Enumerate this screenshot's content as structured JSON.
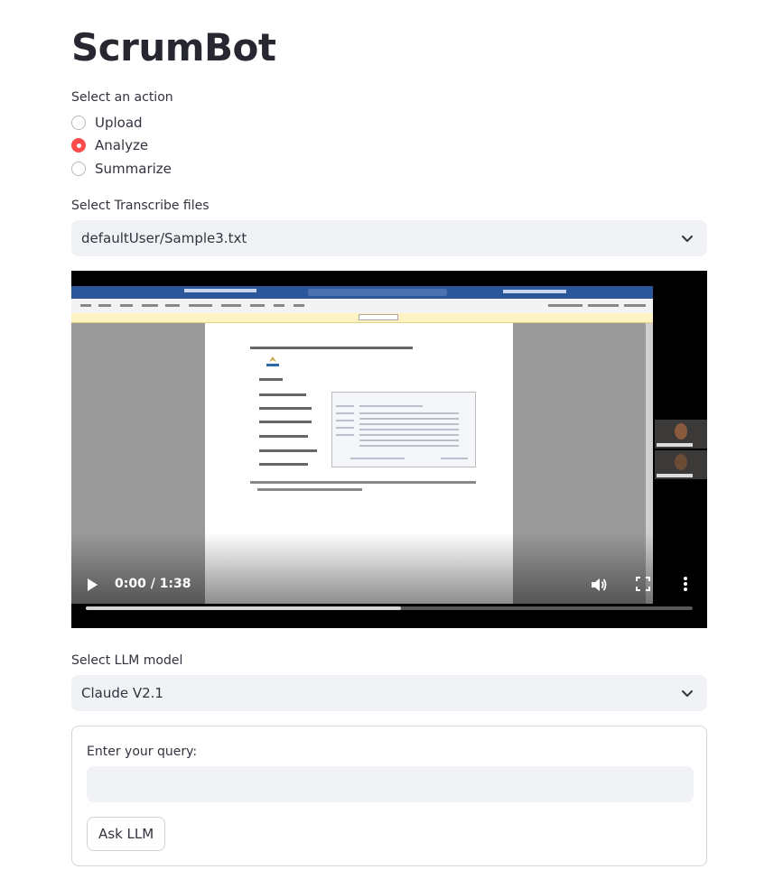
{
  "app": {
    "title": "ScrumBot"
  },
  "action": {
    "label": "Select an action",
    "options": [
      {
        "label": "Upload",
        "selected": false
      },
      {
        "label": "Analyze",
        "selected": true
      },
      {
        "label": "Summarize",
        "selected": false
      }
    ]
  },
  "transcribe": {
    "label": "Select Transcribe files",
    "selected_value": "defaultUser/Sample3.txt"
  },
  "video": {
    "time_display": "0:00 / 1:38",
    "current_time": "0:00",
    "duration": "1:38",
    "buffered_fraction": 0.52,
    "icons": [
      "play-icon",
      "volume-icon",
      "fullscreen-icon",
      "more-options-icon"
    ]
  },
  "llm": {
    "label": "Select LLM model",
    "selected_value": "Claude V2.1"
  },
  "query_form": {
    "label": "Enter your query:",
    "value": "",
    "placeholder": "",
    "button_label": "Ask LLM"
  },
  "colors": {
    "accent": "#ff4b4b",
    "input_bg": "#f0f2f6",
    "text": "#31333f",
    "title": "#262730"
  }
}
